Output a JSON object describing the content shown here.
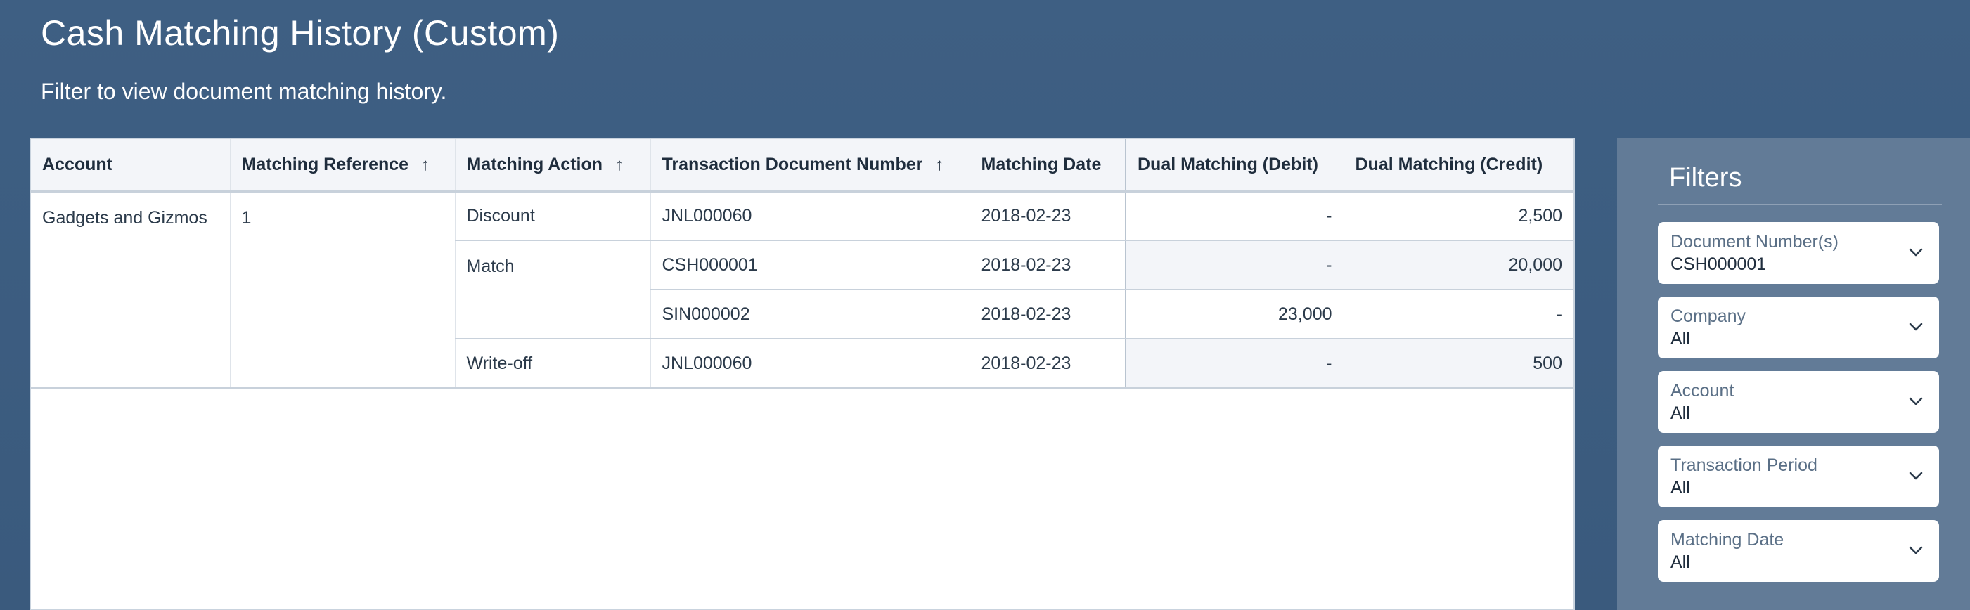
{
  "header": {
    "title": "Cash Matching History (Custom)",
    "subtitle": "Filter to view document matching history."
  },
  "table": {
    "columns": [
      {
        "label": "Account",
        "sort": null
      },
      {
        "label": "Matching Reference",
        "sort": "ascending"
      },
      {
        "label": "Matching Action",
        "sort": "ascending"
      },
      {
        "label": "Transaction Document Number",
        "sort": "ascending"
      },
      {
        "label": "Matching Date",
        "sort": null
      },
      {
        "label": "Dual Matching (Debit)",
        "sort": null
      },
      {
        "label": "Dual Matching (Credit)",
        "sort": null
      }
    ],
    "sort_icon": "arrow-up-icon",
    "account": "Gadgets and Gizmos",
    "matching_reference": "1",
    "actions": {
      "discount": "Discount",
      "match": "Match",
      "write_off": "Write-off"
    },
    "rows": [
      {
        "document": "JNL000060",
        "date": "2018-02-23",
        "debit": "-",
        "credit": "2,500"
      },
      {
        "document": "CSH000001",
        "date": "2018-02-23",
        "debit": "-",
        "credit": "20,000"
      },
      {
        "document": "SIN000002",
        "date": "2018-02-23",
        "debit": "23,000",
        "credit": "-"
      },
      {
        "document": "JNL000060",
        "date": "2018-02-23",
        "debit": "-",
        "credit": "500"
      }
    ]
  },
  "filters": {
    "title": "Filters",
    "chevron_icon": "chevron-down-icon",
    "items": [
      {
        "label": "Document Number(s)",
        "value": "CSH000001"
      },
      {
        "label": "Company",
        "value": "All"
      },
      {
        "label": "Account",
        "value": "All"
      },
      {
        "label": "Transaction Period",
        "value": "All"
      },
      {
        "label": "Matching Date",
        "value": "All"
      }
    ]
  },
  "colors": {
    "background": "#3e5f83",
    "filters_panel": "#627b97",
    "header_row": "#f3f5f9",
    "text": "#1f2d3d"
  }
}
